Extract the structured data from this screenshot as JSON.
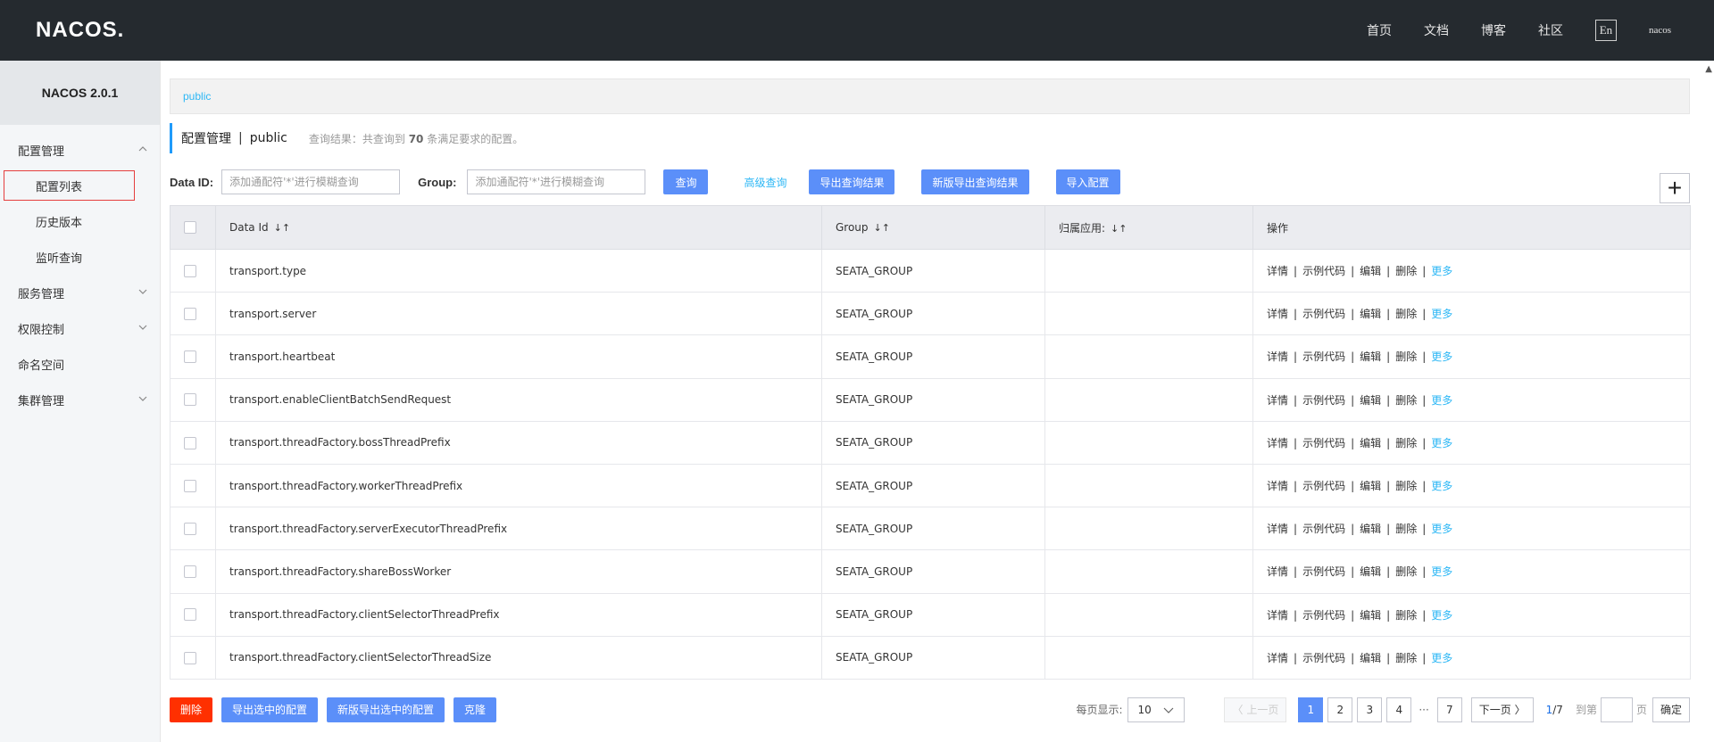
{
  "header": {
    "logo": "NACOS.",
    "nav": [
      "首页",
      "文档",
      "博客",
      "社区"
    ],
    "lang": "En",
    "user": "nacos"
  },
  "sidebar": {
    "brand": "NACOS 2.0.1",
    "items": [
      {
        "label": "配置管理",
        "level": 1,
        "chevron": "up"
      },
      {
        "label": "配置列表",
        "level": 2,
        "active": true
      },
      {
        "label": "历史版本",
        "level": 2
      },
      {
        "label": "监听查询",
        "level": 2
      },
      {
        "label": "服务管理",
        "level": 1,
        "chevron": "down"
      },
      {
        "label": "权限控制",
        "level": 1,
        "chevron": "down"
      },
      {
        "label": "命名空间",
        "level": 1
      },
      {
        "label": "集群管理",
        "level": 1,
        "chevron": "down"
      }
    ]
  },
  "main": {
    "namespace_tab": "public",
    "title": "配置管理",
    "title_sep": "|",
    "title_ns": "public",
    "summary_prefix": "查询结果：共查询到",
    "summary_count": "70",
    "summary_suffix": "条满足要求的配置。",
    "search": {
      "dataid_label": "Data ID:",
      "dataid_placeholder": "添加通配符'*'进行模糊查询",
      "group_label": "Group:",
      "group_placeholder": "添加通配符'*'进行模糊查询",
      "query_btn": "查询",
      "advanced_link": "高级查询",
      "export_btn": "导出查询结果",
      "new_export_btn": "新版导出查询结果",
      "import_btn": "导入配置",
      "add_btn": "+"
    },
    "table": {
      "columns": [
        "Data Id",
        "Group",
        "归属应用:",
        "操作"
      ],
      "ops": [
        "详情",
        "示例代码",
        "编辑",
        "删除",
        "更多"
      ],
      "rows": [
        {
          "data_id": "transport.type",
          "group": "SEATA_GROUP",
          "app": ""
        },
        {
          "data_id": "transport.server",
          "group": "SEATA_GROUP",
          "app": ""
        },
        {
          "data_id": "transport.heartbeat",
          "group": "SEATA_GROUP",
          "app": ""
        },
        {
          "data_id": "transport.enableClientBatchSendRequest",
          "group": "SEATA_GROUP",
          "app": ""
        },
        {
          "data_id": "transport.threadFactory.bossThreadPrefix",
          "group": "SEATA_GROUP",
          "app": ""
        },
        {
          "data_id": "transport.threadFactory.workerThreadPrefix",
          "group": "SEATA_GROUP",
          "app": ""
        },
        {
          "data_id": "transport.threadFactory.serverExecutorThreadPrefix",
          "group": "SEATA_GROUP",
          "app": ""
        },
        {
          "data_id": "transport.threadFactory.shareBossWorker",
          "group": "SEATA_GROUP",
          "app": ""
        },
        {
          "data_id": "transport.threadFactory.clientSelectorThreadPrefix",
          "group": "SEATA_GROUP",
          "app": ""
        },
        {
          "data_id": "transport.threadFactory.clientSelectorThreadSize",
          "group": "SEATA_GROUP",
          "app": ""
        }
      ]
    },
    "footer": {
      "delete_btn": "删除",
      "export_selected_btn": "导出选中的配置",
      "new_export_selected_btn": "新版导出选中的配置",
      "clone_btn": "克隆"
    },
    "pagination": {
      "page_size_label": "每页显示:",
      "page_size": "10",
      "prev": "上一页",
      "pages": [
        "1",
        "2",
        "3",
        "4"
      ],
      "ellipsis": "···",
      "last_page": "7",
      "next": "下一页",
      "current": "1",
      "total": "/7",
      "goto_label": "到第",
      "goto_unit": "页",
      "confirm": "确定"
    }
  }
}
